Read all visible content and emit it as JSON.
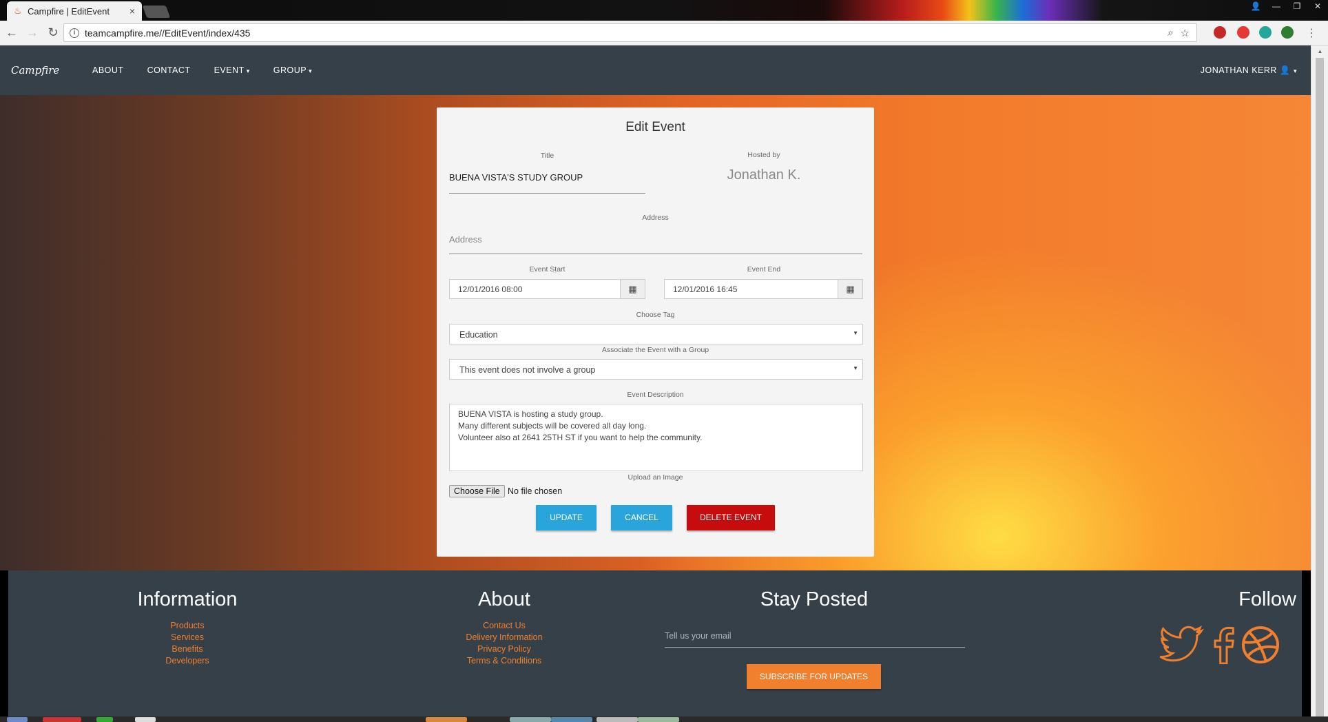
{
  "browser": {
    "tab_title": "Campfire | EditEvent",
    "tab_close": "×",
    "url": "teamcampfire.me//EditEvent/index/435"
  },
  "nav": {
    "logo": "Campfire",
    "links": [
      "ABOUT",
      "CONTACT",
      "EVENT",
      "GROUP"
    ],
    "user": "JONATHAN KERR"
  },
  "form": {
    "heading": "Edit Event",
    "title_label": "Title",
    "title_value": "BUENA VISTA'S STUDY GROUP",
    "hosted_label": "Hosted by",
    "hosted_value": "Jonathan K.",
    "address_label": "Address",
    "address_placeholder": "Address",
    "start_label": "Event Start",
    "start_value": "12/01/2016 08:00",
    "end_label": "Event End",
    "end_value": "12/01/2016 16:45",
    "tag_label": "Choose Tag",
    "tag_value": "Education",
    "group_label": "Associate the Event with a Group",
    "group_value": "This event does not involve a group",
    "description_label": "Event Description",
    "description_lines": [
      "BUENA VISTA is hosting a study group.",
      "Many different subjects will be covered all day long.",
      "Volunteer also at 2641 25TH ST if you want to help the community."
    ],
    "upload_label": "Upload an Image",
    "choose_file": "Choose File",
    "no_file": "No file chosen",
    "update": "UPDATE",
    "cancel": "CANCEL",
    "delete": "DELETE EVENT"
  },
  "footer": {
    "information": {
      "heading": "Information",
      "links": [
        "Products",
        "Services",
        "Benefits",
        "Developers"
      ]
    },
    "about": {
      "heading": "About",
      "links": [
        "Contact Us",
        "Delivery Information",
        "Privacy Policy",
        "Terms & Conditions"
      ]
    },
    "stay_posted": {
      "heading": "Stay Posted",
      "email_placeholder": "Tell us your email",
      "subscribe": "SUBSCRIBE FOR UPDATES"
    },
    "follow": {
      "heading": "Follow",
      "icons": [
        "twitter-icon",
        "facebook-icon",
        "dribbble-icon"
      ]
    }
  },
  "colors": {
    "nav_bg": "#364048",
    "accent_orange": "#f07f2e",
    "button_blue": "#2aa5dc",
    "button_red": "#c60c0c"
  }
}
